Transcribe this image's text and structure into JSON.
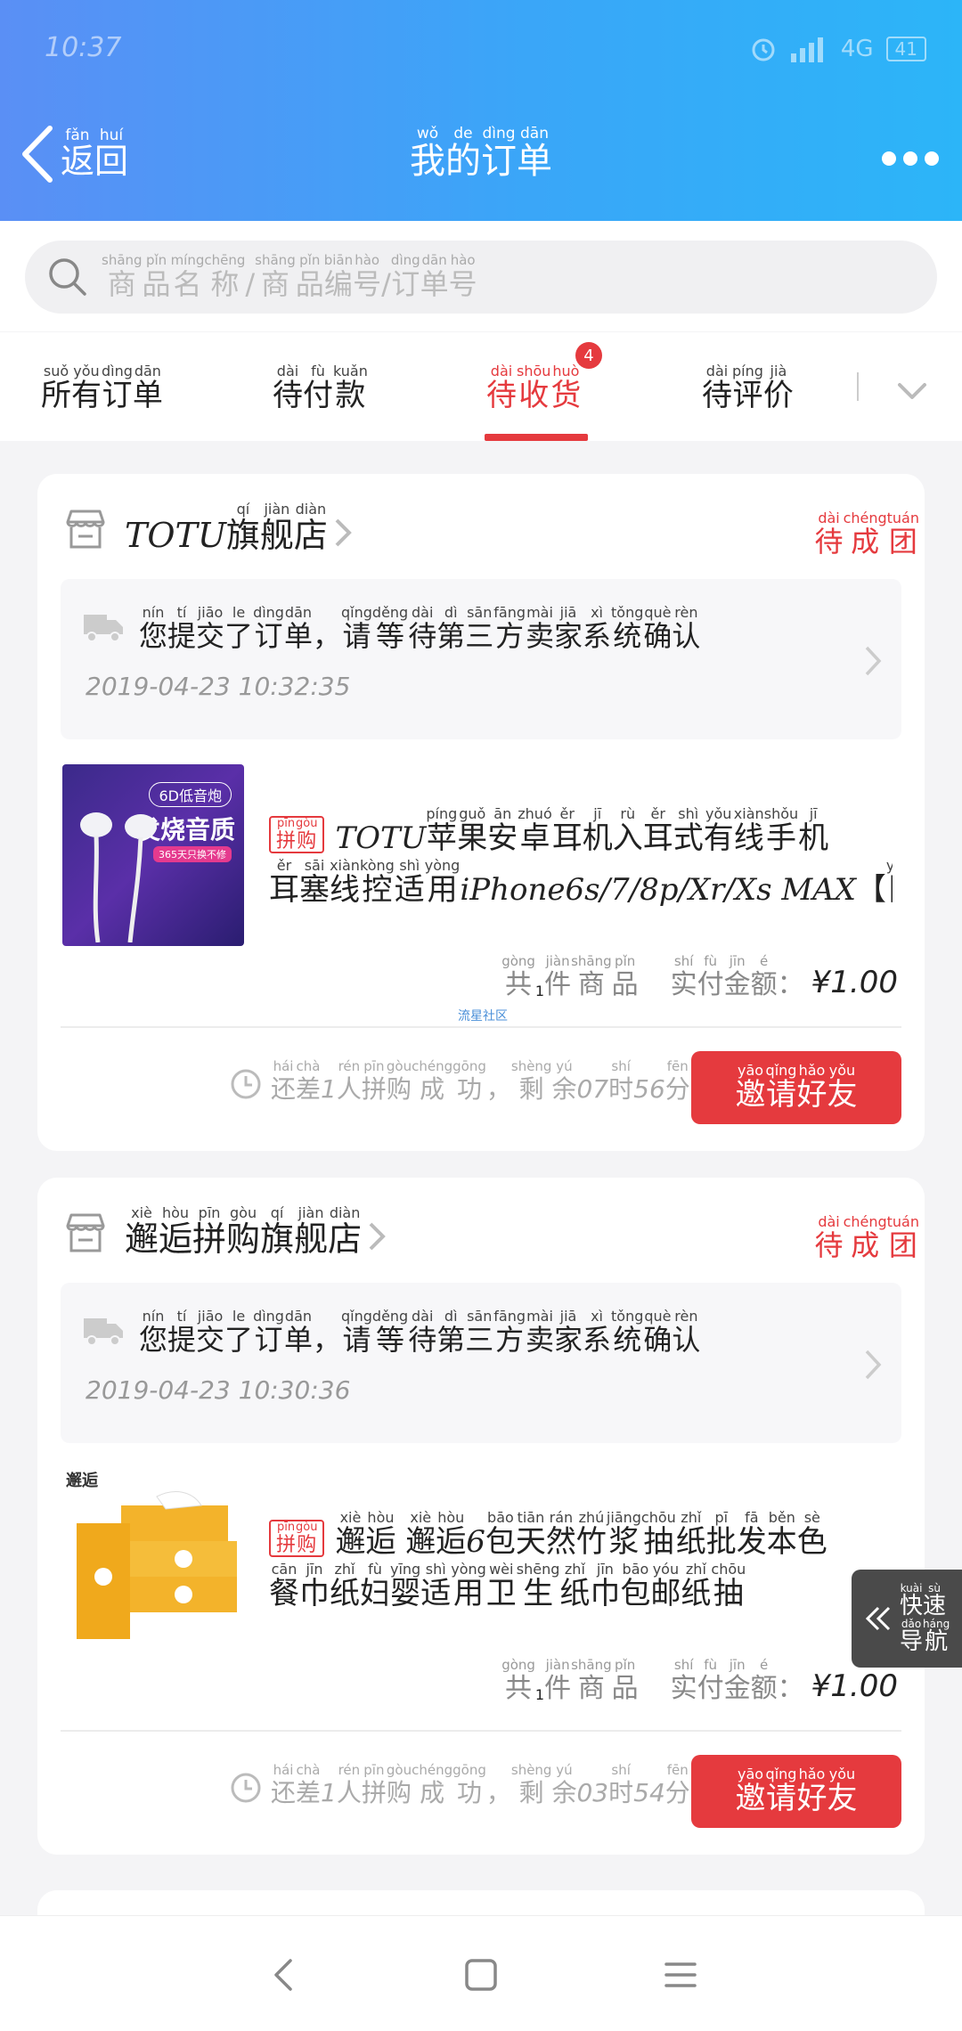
{
  "status_bar": {
    "time": "10:37",
    "network": "4G",
    "battery": "41"
  },
  "header": {
    "back": [
      [
        "fǎn",
        "返"
      ],
      [
        "huí",
        "回"
      ]
    ],
    "title": [
      [
        "wǒ",
        "我"
      ],
      [
        "de",
        "的"
      ],
      [
        "dìng",
        "订"
      ],
      [
        "dān",
        "单"
      ]
    ]
  },
  "search": {
    "placeholder": [
      [
        "shāng",
        "商"
      ],
      [
        "pǐn",
        "品"
      ],
      [
        "míng",
        "名"
      ],
      [
        "chēng",
        "称"
      ],
      [
        "",
        "/"
      ],
      [
        "shāng",
        "商"
      ],
      [
        "pǐn",
        "品"
      ],
      [
        "biān",
        "编"
      ],
      [
        "hào",
        "号"
      ],
      [
        "",
        "/"
      ],
      [
        "dìng",
        "订"
      ],
      [
        "dān",
        "单"
      ],
      [
        "hào",
        "号"
      ]
    ]
  },
  "tabs": {
    "items": [
      [
        [
          "suǒ",
          "所"
        ],
        [
          "yǒu",
          "有"
        ],
        [
          "dìng",
          "订"
        ],
        [
          "dān",
          "单"
        ]
      ],
      [
        [
          "dài",
          "待"
        ],
        [
          "fù",
          "付"
        ],
        [
          "kuǎn",
          "款"
        ]
      ],
      [
        [
          "dài",
          "待"
        ],
        [
          "shōu",
          "收"
        ],
        [
          "huò",
          "货"
        ]
      ],
      [
        [
          "dài",
          "待"
        ],
        [
          "píng",
          "评"
        ],
        [
          "jià",
          "价"
        ]
      ]
    ],
    "active_index": 2,
    "badge": "4"
  },
  "orders": [
    {
      "store_latin": "TOTU",
      "store": [
        [
          "qí",
          "旗"
        ],
        [
          "jiàn",
          "舰"
        ],
        [
          "diàn",
          "店"
        ]
      ],
      "status": [
        [
          "dài",
          "待"
        ],
        [
          "chéng",
          "成"
        ],
        [
          "tuán",
          "团"
        ]
      ],
      "notice": [
        [
          "nín",
          "您"
        ],
        [
          "tí",
          "提"
        ],
        [
          "jiāo",
          "交"
        ],
        [
          "le",
          "了"
        ],
        [
          "dìng",
          "订"
        ],
        [
          "dān",
          "单"
        ],
        [
          "",
          "，"
        ],
        [
          "qǐng",
          "请"
        ],
        [
          "děng",
          "等"
        ],
        [
          "dài",
          "待"
        ],
        [
          "dì",
          "第"
        ],
        [
          "sān",
          "三"
        ],
        [
          "fāng",
          "方"
        ],
        [
          "mài",
          "卖"
        ],
        [
          "jiā",
          "家"
        ],
        [
          "xì",
          "系"
        ],
        [
          "tǒng",
          "统"
        ],
        [
          "què",
          "确"
        ],
        [
          "rèn",
          "认"
        ]
      ],
      "time": "2019-04-23 10:32:35",
      "product_image_name": "earphones-product-image",
      "thumb_text": {
        "tag": "6D低音炮",
        "big": "发烧音质",
        "sub": "365天只换不修"
      },
      "pill": [
        [
          "pīn",
          "拼"
        ],
        [
          "gòu",
          "购"
        ]
      ],
      "title_line1": [
        [
          "L",
          "TOTU "
        ],
        [
          "píng",
          "苹"
        ],
        [
          "guǒ",
          "果"
        ],
        [
          "ān",
          "安"
        ],
        [
          "zhuó",
          "卓"
        ],
        [
          "ěr",
          "耳"
        ],
        [
          "jī",
          "机"
        ],
        [
          "rù",
          "入"
        ],
        [
          "ěr",
          "耳"
        ],
        [
          "shì",
          "式"
        ],
        [
          "yǒu",
          "有"
        ],
        [
          "xiàn",
          "线"
        ],
        [
          "shǒu",
          "手"
        ],
        [
          "jī",
          "机"
        ]
      ],
      "title_line2": [
        [
          "ěr",
          "耳"
        ],
        [
          "sāi",
          "塞"
        ],
        [
          "xiàn",
          "线"
        ],
        [
          "kòng",
          "控"
        ],
        [
          "shì",
          "适"
        ],
        [
          "yòng",
          "用"
        ],
        [
          "L",
          "iPhone6s/7/8p/Xr/Xs MAX"
        ],
        [
          "",
          "【"
        ],
        [
          "yuán",
          "圆"
        ],
        [
          "",
          "…"
        ]
      ],
      "count_label": [
        [
          "gòng",
          "共"
        ],
        [
          "L",
          "1"
        ],
        [
          "jiàn",
          "件"
        ],
        [
          "shāng",
          "商"
        ],
        [
          "pǐn",
          "品"
        ]
      ],
      "paid_label": [
        [
          "shí",
          "实"
        ],
        [
          "fù",
          "付"
        ],
        [
          "jīn",
          "金"
        ],
        [
          "é",
          "额"
        ],
        [
          "",
          "："
        ]
      ],
      "price": "¥1.00",
      "countdown": [
        [
          "hái",
          "还"
        ],
        [
          "chà",
          "差"
        ],
        [
          "L",
          "1"
        ],
        [
          "rén",
          "人"
        ],
        [
          "pīn",
          "拼"
        ],
        [
          "gòu",
          "购"
        ],
        [
          "chéng",
          "成"
        ],
        [
          "gōng",
          "功"
        ],
        [
          "",
          "，"
        ],
        [
          "shèng",
          "剩"
        ],
        [
          "yú",
          "余"
        ],
        [
          "L",
          "07"
        ],
        [
          "shí",
          "时"
        ],
        [
          "L",
          "56"
        ],
        [
          "fēn",
          "分"
        ]
      ],
      "invite": [
        [
          "yāo",
          "邀"
        ],
        [
          "qǐng",
          "请"
        ],
        [
          "hǎo",
          "好"
        ],
        [
          "yǒu",
          "友"
        ]
      ]
    },
    {
      "store_latin": "",
      "store": [
        [
          "xiè",
          "邂"
        ],
        [
          "hòu",
          "逅"
        ],
        [
          "pīn",
          "拼"
        ],
        [
          "gòu",
          "购"
        ],
        [
          "qí",
          "旗"
        ],
        [
          "jiàn",
          "舰"
        ],
        [
          "diàn",
          "店"
        ]
      ],
      "status": [
        [
          "dài",
          "待"
        ],
        [
          "chéng",
          "成"
        ],
        [
          "tuán",
          "团"
        ]
      ],
      "notice": [
        [
          "nín",
          "您"
        ],
        [
          "tí",
          "提"
        ],
        [
          "jiāo",
          "交"
        ],
        [
          "le",
          "了"
        ],
        [
          "dìng",
          "订"
        ],
        [
          "dān",
          "单"
        ],
        [
          "",
          "，"
        ],
        [
          "qǐng",
          "请"
        ],
        [
          "děng",
          "等"
        ],
        [
          "dài",
          "待"
        ],
        [
          "dì",
          "第"
        ],
        [
          "sān",
          "三"
        ],
        [
          "fāng",
          "方"
        ],
        [
          "mài",
          "卖"
        ],
        [
          "jiā",
          "家"
        ],
        [
          "xì",
          "系"
        ],
        [
          "tǒng",
          "统"
        ],
        [
          "què",
          "确"
        ],
        [
          "rèn",
          "认"
        ]
      ],
      "time": "2019-04-23 10:30:36",
      "product_image_name": "tissue-product-image",
      "thumb_text": {
        "tag": "邂逅",
        "big": "",
        "sub": ""
      },
      "pill": [
        [
          "pīn",
          "拼"
        ],
        [
          "gòu",
          "购"
        ]
      ],
      "title_line1": [
        [
          "xiè",
          "邂"
        ],
        [
          "hòu",
          "逅"
        ],
        [
          "",
          ""
        ],
        [
          "xiè",
          "邂"
        ],
        [
          "hòu",
          "逅"
        ],
        [
          "L",
          "6"
        ],
        [
          "bāo",
          "包"
        ],
        [
          "tiān",
          "天"
        ],
        [
          "rán",
          "然"
        ],
        [
          "zhú",
          "竹"
        ],
        [
          "jiāng",
          "浆"
        ],
        [
          "chōu",
          "抽"
        ],
        [
          "zhǐ",
          "纸"
        ],
        [
          "pī",
          "批"
        ],
        [
          "fā",
          "发"
        ],
        [
          "běn",
          "本"
        ],
        [
          "sè",
          "色"
        ]
      ],
      "title_line2": [
        [
          "cān",
          "餐"
        ],
        [
          "jīn",
          "巾"
        ],
        [
          "zhǐ",
          "纸"
        ],
        [
          "fù",
          "妇"
        ],
        [
          "yīng",
          "婴"
        ],
        [
          "shì",
          "适"
        ],
        [
          "yòng",
          "用"
        ],
        [
          "wèi",
          "卫"
        ],
        [
          "shēng",
          "生"
        ],
        [
          "zhǐ",
          "纸"
        ],
        [
          "jīn",
          "巾"
        ],
        [
          "bāo",
          "包"
        ],
        [
          "yóu",
          "邮"
        ],
        [
          "zhǐ",
          "纸"
        ],
        [
          "chōu",
          "抽"
        ]
      ],
      "count_label": [
        [
          "gòng",
          "共"
        ],
        [
          "L",
          "1"
        ],
        [
          "jiàn",
          "件"
        ],
        [
          "shāng",
          "商"
        ],
        [
          "pǐn",
          "品"
        ]
      ],
      "paid_label": [
        [
          "shí",
          "实"
        ],
        [
          "fù",
          "付"
        ],
        [
          "jīn",
          "金"
        ],
        [
          "é",
          "额"
        ],
        [
          "",
          "："
        ]
      ],
      "price": "¥1.00",
      "countdown": [
        [
          "hái",
          "还"
        ],
        [
          "chà",
          "差"
        ],
        [
          "L",
          "1"
        ],
        [
          "rén",
          "人"
        ],
        [
          "pīn",
          "拼"
        ],
        [
          "gòu",
          "购"
        ],
        [
          "chéng",
          "成"
        ],
        [
          "gōng",
          "功"
        ],
        [
          "",
          "，"
        ],
        [
          "shèng",
          "剩"
        ],
        [
          "yú",
          "余"
        ],
        [
          "L",
          "03"
        ],
        [
          "shí",
          "时"
        ],
        [
          "L",
          "54"
        ],
        [
          "fēn",
          "分"
        ]
      ],
      "invite": [
        [
          "yāo",
          "邀"
        ],
        [
          "qǐng",
          "请"
        ],
        [
          "hǎo",
          "好"
        ],
        [
          "yǒu",
          "友"
        ]
      ]
    }
  ],
  "watermark": "流星社区",
  "quick_nav": [
    [
      [
        "kuài",
        "快"
      ],
      [
        "sù",
        "速"
      ]
    ],
    [
      [
        "dǎo",
        "导"
      ],
      [
        "háng",
        "航"
      ]
    ]
  ],
  "colors": {
    "accent": "#e53a3e",
    "header_start": "#5a8ff5",
    "header_end": "#2cb5f8"
  }
}
